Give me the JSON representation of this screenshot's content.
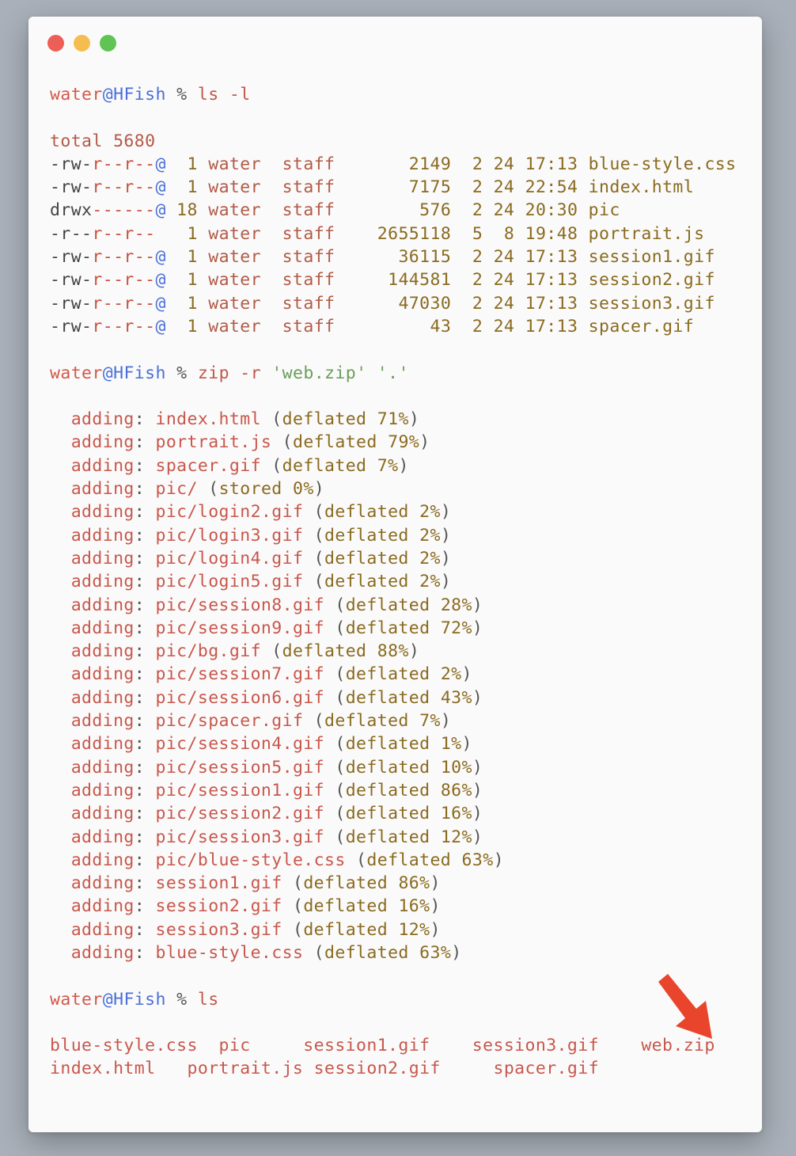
{
  "window": {
    "traffic_lights": [
      "close",
      "minimize",
      "zoom"
    ]
  },
  "prompt": {
    "user": "water",
    "host": "HFish",
    "symbol": "%"
  },
  "commands": [
    {
      "cmd": "ls",
      "args": " -l"
    },
    {
      "cmd": "zip",
      "args": " -r ",
      "arg_str1": "'web.zip'",
      "arg_str2": "'.'"
    },
    {
      "cmd": "ls",
      "args": ""
    }
  ],
  "ls_l": {
    "total": "total 5680",
    "rows": [
      {
        "perm_a": "-rw-",
        "perm_b": "r--r--",
        "perm_c": "@",
        "links": " 1",
        "owner": "water",
        "group": "staff",
        "size": "2149",
        "month": "2",
        "day": "24",
        "time": "17:13",
        "name": "blue-style.css"
      },
      {
        "perm_a": "-rw-",
        "perm_b": "r--r--",
        "perm_c": "@",
        "links": " 1",
        "owner": "water",
        "group": "staff",
        "size": "7175",
        "month": "2",
        "day": "24",
        "time": "22:54",
        "name": "index.html"
      },
      {
        "perm_a": "drwx",
        "perm_b": "------",
        "perm_c": "@",
        "links": "18",
        "owner": "water",
        "group": "staff",
        "size": "576",
        "month": "2",
        "day": "24",
        "time": "20:30",
        "name": "pic"
      },
      {
        "perm_a": "-r--",
        "perm_b": "r--r--",
        "perm_c": " ",
        "links": " 1",
        "owner": "water",
        "group": "staff",
        "size": "2655118",
        "month": "5",
        "day": "8",
        "time": "19:48",
        "name": "portrait.js"
      },
      {
        "perm_a": "-rw-",
        "perm_b": "r--r--",
        "perm_c": "@",
        "links": " 1",
        "owner": "water",
        "group": "staff",
        "size": "36115",
        "month": "2",
        "day": "24",
        "time": "17:13",
        "name": "session1.gif"
      },
      {
        "perm_a": "-rw-",
        "perm_b": "r--r--",
        "perm_c": "@",
        "links": " 1",
        "owner": "water",
        "group": "staff",
        "size": "144581",
        "month": "2",
        "day": "24",
        "time": "17:13",
        "name": "session2.gif"
      },
      {
        "perm_a": "-rw-",
        "perm_b": "r--r--",
        "perm_c": "@",
        "links": " 1",
        "owner": "water",
        "group": "staff",
        "size": "47030",
        "month": "2",
        "day": "24",
        "time": "17:13",
        "name": "session3.gif"
      },
      {
        "perm_a": "-rw-",
        "perm_b": "r--r--",
        "perm_c": "@",
        "links": " 1",
        "owner": "water",
        "group": "staff",
        "size": "43",
        "month": "2",
        "day": "24",
        "time": "17:13",
        "name": "spacer.gif"
      }
    ]
  },
  "zip_output": [
    {
      "file": "index.html",
      "method": "deflated",
      "pct": "71%"
    },
    {
      "file": "portrait.js",
      "method": "deflated",
      "pct": "79%"
    },
    {
      "file": "spacer.gif",
      "method": "deflated",
      "pct": "7%"
    },
    {
      "file": "pic/",
      "method": "stored",
      "pct": "0%"
    },
    {
      "file": "pic/login2.gif",
      "method": "deflated",
      "pct": "2%"
    },
    {
      "file": "pic/login3.gif",
      "method": "deflated",
      "pct": "2%"
    },
    {
      "file": "pic/login4.gif",
      "method": "deflated",
      "pct": "2%"
    },
    {
      "file": "pic/login5.gif",
      "method": "deflated",
      "pct": "2%"
    },
    {
      "file": "pic/session8.gif",
      "method": "deflated",
      "pct": "28%"
    },
    {
      "file": "pic/session9.gif",
      "method": "deflated",
      "pct": "72%"
    },
    {
      "file": "pic/bg.gif",
      "method": "deflated",
      "pct": "88%"
    },
    {
      "file": "pic/session7.gif",
      "method": "deflated",
      "pct": "2%"
    },
    {
      "file": "pic/session6.gif",
      "method": "deflated",
      "pct": "43%"
    },
    {
      "file": "pic/spacer.gif",
      "method": "deflated",
      "pct": "7%"
    },
    {
      "file": "pic/session4.gif",
      "method": "deflated",
      "pct": "1%"
    },
    {
      "file": "pic/session5.gif",
      "method": "deflated",
      "pct": "10%"
    },
    {
      "file": "pic/session1.gif",
      "method": "deflated",
      "pct": "86%"
    },
    {
      "file": "pic/session2.gif",
      "method": "deflated",
      "pct": "16%"
    },
    {
      "file": "pic/session3.gif",
      "method": "deflated",
      "pct": "12%"
    },
    {
      "file": "pic/blue-style.css",
      "method": "deflated",
      "pct": "63%"
    },
    {
      "file": "session1.gif",
      "method": "deflated",
      "pct": "86%"
    },
    {
      "file": "session2.gif",
      "method": "deflated",
      "pct": "16%"
    },
    {
      "file": "session3.gif",
      "method": "deflated",
      "pct": "12%"
    },
    {
      "file": "blue-style.css",
      "method": "deflated",
      "pct": "63%"
    }
  ],
  "adding_label": "adding",
  "ls_output": {
    "row1": [
      "blue-style.css",
      "pic",
      "session1.gif",
      "session3.gif",
      "web.zip"
    ],
    "row2": [
      "index.html",
      "portrait.js",
      "session2.gif",
      "spacer.gif"
    ]
  },
  "colors": {
    "arrow": "#e8452c"
  }
}
